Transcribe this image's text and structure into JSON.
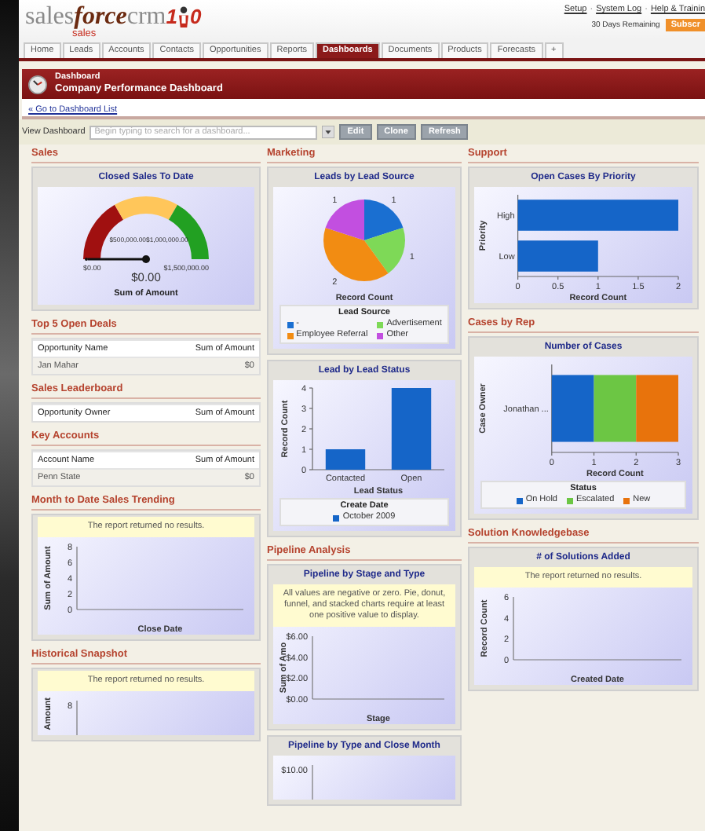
{
  "header": {
    "logo": {
      "part_1": "sales",
      "part_2": "force",
      "part_3": "crm",
      "tagline": "sales",
      "digit_1": "1",
      "digit_2": "0"
    },
    "links": [
      "Setup",
      "System Log",
      "Help & Trainin"
    ],
    "separator": "·",
    "trial": "30 Days Remaining",
    "subscribe": "Subscr"
  },
  "tabs": [
    {
      "label": "Home",
      "selected": false
    },
    {
      "label": "Leads",
      "selected": false
    },
    {
      "label": "Accounts",
      "selected": false
    },
    {
      "label": "Contacts",
      "selected": false
    },
    {
      "label": "Opportunities",
      "selected": false
    },
    {
      "label": "Reports",
      "selected": false
    },
    {
      "label": "Dashboards",
      "selected": true
    },
    {
      "label": "Documents",
      "selected": false
    },
    {
      "label": "Products",
      "selected": false
    },
    {
      "label": "Forecasts",
      "selected": false
    },
    {
      "label": "+",
      "selected": false
    }
  ],
  "banner": {
    "title": "Dashboard",
    "subtitle": "Company Performance Dashboard"
  },
  "back_link": "« Go to Dashboard List",
  "toolbar": {
    "label": "View Dashboard",
    "placeholder": "Begin typing to search for a dashboard...",
    "buttons": [
      "Edit",
      "Clone",
      "Refresh"
    ]
  },
  "columns": [
    {
      "sections": [
        {
          "title": "Sales",
          "items": [
            {
              "kind": "gauge",
              "title": "Closed Sales To Date",
              "min": "$0.00",
              "max": "$1,500,000.00",
              "marks": [
                "$500,000.00",
                "$1,000,000.00"
              ],
              "value": "$0.00",
              "footer": "Sum of Amount",
              "level": 0
            }
          ]
        },
        {
          "title": "Top 5 Open Deals",
          "items": [
            {
              "kind": "table",
              "columns": [
                "Opportunity Name",
                "Sum of Amount"
              ],
              "rows": [
                [
                  "Jan Mahar",
                  "$0"
                ]
              ]
            }
          ]
        },
        {
          "title": "Sales Leaderboard",
          "items": [
            {
              "kind": "table",
              "columns": [
                "Opportunity Owner",
                "Sum of Amount"
              ]
            }
          ]
        },
        {
          "title": "Key Accounts",
          "items": [
            {
              "kind": "table",
              "columns": [
                "Account Name",
                "Sum of Amount"
              ],
              "rows": [
                [
                  "Penn State",
                  "$0"
                ]
              ]
            }
          ]
        },
        {
          "title": "Month to Date Sales Trending",
          "items": [
            {
              "kind": "empty",
              "message": "The report returned no results.",
              "ylabel": "Sum of Amount",
              "yticks": [
                "8",
                "6",
                "4",
                "2",
                "0"
              ],
              "xlabel": "Close Date"
            }
          ]
        },
        {
          "title": "Historical Snapshot",
          "items": [
            {
              "kind": "empty",
              "message": "The report returned no results.",
              "ylabel": "Amount",
              "yticks": [
                "8"
              ]
            }
          ]
        }
      ]
    },
    {
      "sections": [
        {
          "title": "Marketing",
          "items": [
            {
              "kind": "chart",
              "title": "Leads by Lead Source",
              "legend_title": "Lead Source",
              "slices": [
                {
                  "color": "#1a6fd1"
                },
                {
                  "color": "#7ed957"
                },
                {
                  "color": "#f28c12"
                },
                {
                  "color": "#c24fe0"
                }
              ],
              "chart_data": {
                "type": "pie",
                "categories": [
                  "-",
                  "Advertisement",
                  "Employee Referral",
                  "Other"
                ],
                "values": [
                  1,
                  1,
                  2,
                  1
                ],
                "data_labels": true,
                "xlabel": "Record Count"
              }
            },
            {
              "kind": "chart",
              "title": "Lead by Lead Status",
              "legend_title": "Create Date",
              "chart_data": {
                "type": "bar",
                "orientation": "vertical",
                "categories": [
                  "Contacted",
                  "Open"
                ],
                "series": [
                  {
                    "name": "October 2009",
                    "color": "#1565c8",
                    "values": [
                      1,
                      4
                    ]
                  }
                ],
                "xlabel": "Lead Status",
                "ylabel": "Record Count",
                "ylim": [
                  0,
                  4
                ],
                "yticks": [
                  0,
                  1,
                  2,
                  3,
                  4
                ]
              }
            }
          ]
        },
        {
          "title": "Pipeline Analysis",
          "items": [
            {
              "kind": "empty",
              "title": "Pipeline by Stage and Type",
              "message": "All values are negative or zero. Pie, donut, funnel, and stacked charts require at least one positive value to display.",
              "ylabel": "Sum of Amo",
              "yticks": [
                "$6.00",
                "$4.00",
                "$2.00",
                "$0.00"
              ],
              "xlabel": "Stage"
            },
            {
              "kind": "empty",
              "title": "Pipeline by Type and Close Month",
              "yticks": [
                "$10.00"
              ]
            }
          ]
        }
      ]
    },
    {
      "sections": [
        {
          "title": "Support",
          "items": [
            {
              "kind": "chart",
              "title": "Open Cases By Priority",
              "chart_data": {
                "type": "bar",
                "orientation": "horizontal",
                "categories": [
                  "High",
                  "Low"
                ],
                "series": [
                  {
                    "color": "#1565c8",
                    "values": [
                      2,
                      1
                    ]
                  }
                ],
                "xlabel": "Record Count",
                "ylabel": "Priority",
                "xlim": [
                  0,
                  2
                ],
                "xticks": [
                  0,
                  0.5,
                  1,
                  1.5,
                  2
                ]
              }
            }
          ]
        },
        {
          "title": "Cases by Rep",
          "items": [
            {
              "kind": "chart",
              "title": "Number of Cases",
              "legend_title": "Status",
              "chart_data": {
                "type": "bar",
                "orientation": "horizontal",
                "stacked": true,
                "categories": [
                  "Jonathan ..."
                ],
                "series": [
                  {
                    "name": "On Hold",
                    "color": "#1565c8",
                    "values": [
                      1
                    ]
                  },
                  {
                    "name": "Escalated",
                    "color": "#6cc644",
                    "values": [
                      1
                    ]
                  },
                  {
                    "name": "New",
                    "color": "#e8730c",
                    "values": [
                      1
                    ]
                  }
                ],
                "xlabel": "Record Count",
                "ylabel": "Case Owner",
                "xlim": [
                  0,
                  3
                ],
                "xticks": [
                  0,
                  1,
                  2,
                  3
                ]
              }
            }
          ]
        },
        {
          "title": "Solution Knowledgebase",
          "items": [
            {
              "kind": "empty",
              "title": "# of Solutions Added",
              "message": "The report returned no results.",
              "ylabel": "Record Count",
              "yticks": [
                "6",
                "4",
                "2",
                "0"
              ],
              "xlabel": "Created Date"
            }
          ]
        }
      ]
    }
  ]
}
